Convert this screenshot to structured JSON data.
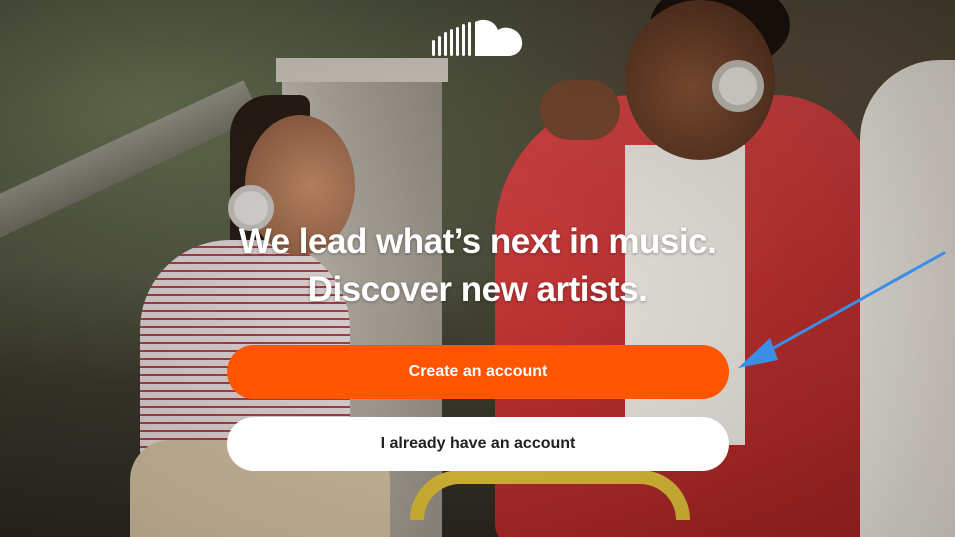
{
  "brand": {
    "logo_icon": "soundcloud-cloud-icon",
    "accent_color": "#ff5500"
  },
  "hero": {
    "headline_line1": "We lead what’s next in music.",
    "headline_line2": "Discover new artists."
  },
  "actions": {
    "create_account_label": "Create an account",
    "login_label": "I already have an account"
  },
  "annotation": {
    "arrow_icon": "pointer-arrow-icon",
    "arrow_color": "#3a8ee6"
  }
}
